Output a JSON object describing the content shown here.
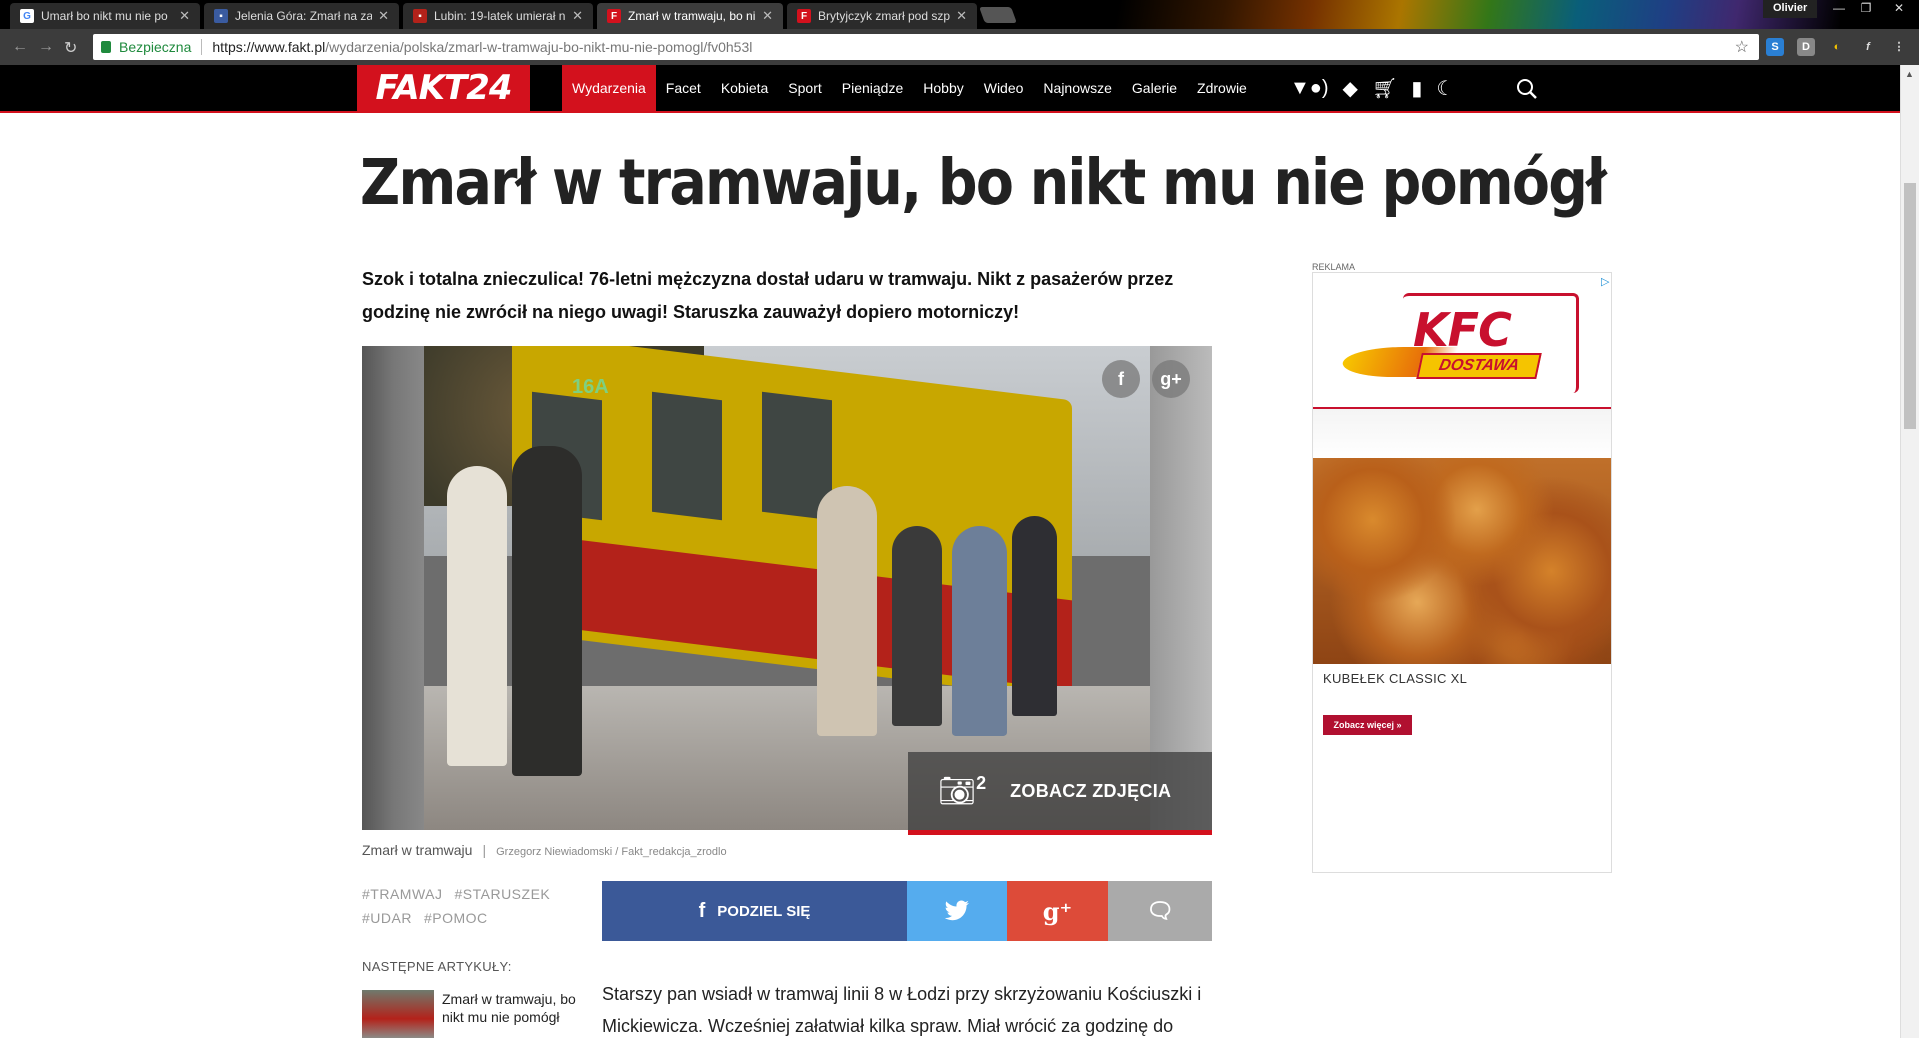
{
  "browser": {
    "tabs": [
      {
        "title": "Umarł bo nikt mu nie po",
        "favicon": "google-icon",
        "color": "#4285f4",
        "active": false
      },
      {
        "title": "Jelenia Góra: Zmarł na za",
        "favicon": "news-icon",
        "color": "#3a5ba0",
        "active": false
      },
      {
        "title": "Lubin: 19-latek umierał n",
        "favicon": "news-icon",
        "color": "#b3221a",
        "active": false
      },
      {
        "title": "Zmarł w tramwaju, bo ni",
        "favicon": "fakt-icon",
        "color": "#d3111d",
        "active": true
      },
      {
        "title": "Brytyjczyk zmarł pod szp",
        "favicon": "fakt-icon",
        "color": "#d3111d",
        "active": false
      }
    ],
    "user": "Olivier",
    "secure_label": "Bezpieczna",
    "url_host": "https://www.fakt.pl",
    "url_path": "/wydarzenia/polska/zmarl-w-tramwaju-bo-nikt-mu-nie-pomogl/fv0h53l"
  },
  "site": {
    "logo": "FAKT24",
    "menu": [
      "Wydarzenia",
      "Facet",
      "Kobieta",
      "Sport",
      "Pieniądze",
      "Hobby",
      "Wideo",
      "Najnowsze",
      "Galerie",
      "Zdrowie"
    ],
    "active_menu": "Wydarzenia",
    "accent": "#d3111d"
  },
  "article": {
    "headline": "Zmarł w tramwaju, bo nikt mu nie pomógł",
    "lead": "Szok i totalna znieczulica! 76-letni mężczyzna dostał udaru w tramwaju. Nikt z pasażerów przez godzinę nie zwrócił na niego uwagi! Staruszka zauważył dopiero motorniczy!",
    "photo": {
      "tram_label": "16A",
      "gallery_count": "2",
      "gallery_label": "ZOBACZ ZDJĘCIA"
    },
    "caption": "Zmarł w tramwaju",
    "caption_separator": "|",
    "author": "Grzegorz Niewiadomski / Fakt_redakcja_zrodlo",
    "tags": [
      "#TRAMWAJ",
      "#STARUSZEK",
      "#UDAR",
      "#POMOC"
    ],
    "share_label": "PODZIEL SIĘ",
    "next_label": "NASTĘPNE ARTYKUŁY:",
    "next_title": "Zmarł w tramwaju, bo nikt mu nie pomógł",
    "body": "Starszy pan wsiadł w tramwaj linii 8 w Łodzi przy skrzyżowaniu Kościuszki i Mickiewicza. Wcześniej załatwiał kilka spraw. Miał wrócić za godzinę do"
  },
  "ad": {
    "label": "REKLAMA",
    "brand": "KFC",
    "tagline": "DOSTAWA",
    "product": "KUBEŁEK CLASSIC XL",
    "cta": "Zobacz więcej »"
  }
}
